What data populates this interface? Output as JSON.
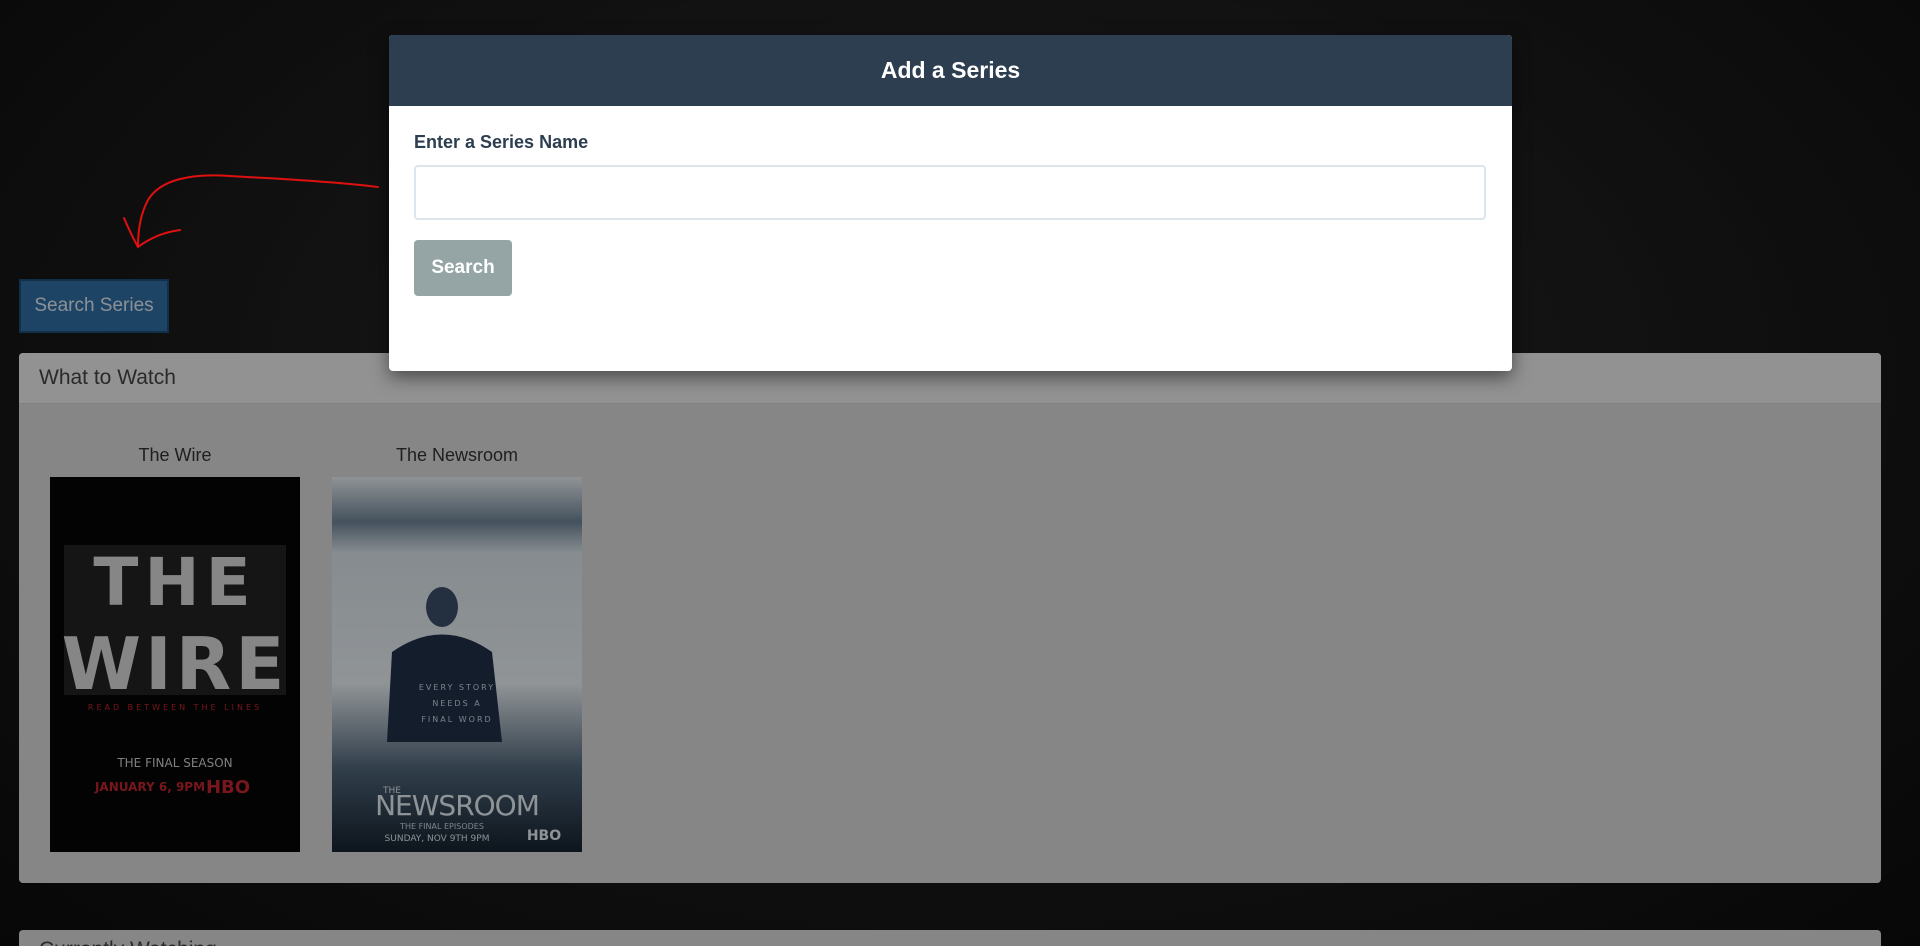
{
  "toolbar": {
    "search_series_label": "Search Series"
  },
  "what_to_watch": {
    "heading": "What to Watch",
    "series": [
      {
        "title": "The Wire",
        "poster": {
          "headline_top": "THE",
          "headline_bottom": "WIRE",
          "tagline": "READ BETWEEN THE LINES",
          "season": "THE FINAL SEASON",
          "date": "JANUARY 6, 9PM",
          "network": "HBO"
        }
      },
      {
        "title": "The Newsroom",
        "poster": {
          "tagline_lines": [
            "EVERY STORY",
            "NEEDS A",
            "FINAL WORD"
          ],
          "logo_small": "THE",
          "logo": "NEWSROOM",
          "episodes": "THE FINAL EPISODES",
          "airdate": "SUNDAY, NOV 9TH 9PM",
          "network": "HBO"
        }
      }
    ]
  },
  "currently_watching": {
    "heading": "Currently Watching"
  },
  "modal": {
    "title": "Add a Series",
    "field_label": "Enter a Series Name",
    "input_value": "",
    "input_placeholder": "",
    "search_button_label": "Search"
  },
  "colors": {
    "modal_header": "#2c3e50",
    "search_button": "#95a5a6",
    "search_series_button": "#2f6fa3",
    "annotation_arrow": "#e01010"
  }
}
